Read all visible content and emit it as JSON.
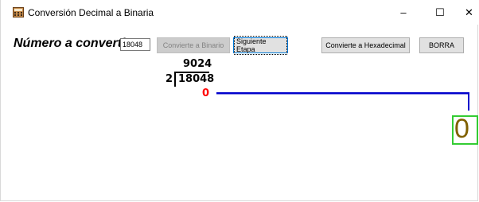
{
  "window": {
    "title": "Conversión Decimal a Binaria",
    "icon": "calculator-icon",
    "controls": {
      "minimize": "–",
      "maximize": "☐",
      "close": "✕"
    }
  },
  "form": {
    "number_label": "Número a convertir:",
    "number_value": "18048",
    "buttons": {
      "to_binary": "Convierte a Binario",
      "next_step": "Siguiente Etapa",
      "to_hex": "Convierte a Hexadecimal",
      "clear": "BORRA"
    }
  },
  "division": {
    "quotient": "9024",
    "divisor": "2",
    "dividend": "18048",
    "remainder": "0"
  },
  "result": {
    "digit": "0"
  },
  "colors": {
    "remainder": "#ff0000",
    "connector": "#0000cc",
    "result_border": "#33cc33",
    "result_digit": "#806000"
  }
}
